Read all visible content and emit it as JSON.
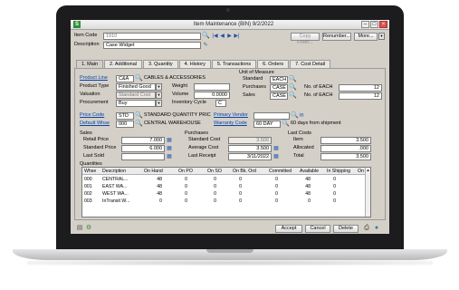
{
  "window": {
    "title": "Item Maintenance (BIN) 9/2/2022",
    "app_icon": "S"
  },
  "header": {
    "item_code_label": "Item Code",
    "item_code_value": "1910",
    "description_label": "Description",
    "description_value": "Case Widget",
    "copy_from_label": "Copy From...",
    "renumber_label": "Renumber...",
    "more_label": "More..."
  },
  "tabs": [
    "1. Main",
    "2. Additional",
    "3. Quantity",
    "4. History",
    "5. Transactions",
    "6. Orders",
    "7. Cost Detail"
  ],
  "main": {
    "product_line_label": "Product Line",
    "product_line_value": "C&A",
    "product_line_desc": "CABLES & ACCESSORIES",
    "product_type_label": "Product Type",
    "product_type_value": "Finished Good",
    "valuation_label": "Valuation",
    "valuation_value": "Standard Cost",
    "procurement_label": "Procurement",
    "procurement_value": "Buy",
    "weight_label": "Weight",
    "weight_value": "",
    "volume_label": "Volume",
    "volume_value": "0.0000",
    "inventory_cycle_label": "Inventory Cycle",
    "inventory_cycle_value": "C",
    "uom_title": "Unit of Measure",
    "uom_standard_label": "Standard",
    "uom_standard_value": "EACH",
    "uom_purchases_label": "Purchases",
    "uom_purchases_value": "CASE",
    "uom_sales_label": "Sales",
    "uom_sales_value": "CASE",
    "no_of_each_label": "No. of  EACH",
    "no_of_each_purchases": "12",
    "no_of_each_sales": "12",
    "price_code_label": "Price Code",
    "price_code_value": "STD",
    "price_code_desc": "STANDARD QUANTITY PRIC",
    "default_whse_label": "Default Whse",
    "default_whse_value": "000",
    "default_whse_desc": "CENTRAL WAREHOUSE",
    "primary_vendor_label": "Primary Vendor",
    "primary_vendor_value": "",
    "warranty_code_label": "Warranty Code",
    "warranty_code_value": "60 DAY",
    "warranty_desc": "60 days from shipment",
    "sales_title": "Sales",
    "retail_price_label": "Retail Price",
    "retail_price_value": "7.000",
    "standard_price_label": "Standard Price",
    "standard_price_value": "6.000",
    "last_sold_label": "Last Sold",
    "last_sold_value": "",
    "purchases_title": "Purchases",
    "standard_cost_label": "Standard Cost",
    "standard_cost_value": "3.500",
    "average_cost_label": "Average Cost",
    "average_cost_value": "3.500",
    "last_receipt_label": "Last Receipt",
    "last_receipt_value": "3/11/2022",
    "last_costs_title": "Last Costs",
    "lc_item_label": "Item",
    "lc_item_value": "3.500",
    "lc_allocated_label": "Allocated",
    "lc_allocated_value": ".000",
    "lc_total_label": "Total",
    "lc_total_value": "3.500"
  },
  "quantities": {
    "title": "Quantities",
    "columns": [
      "Whse",
      "Description",
      "On Hand",
      "On PO",
      "On SO",
      "On Bk. Ord",
      "Committed",
      "Available",
      "In Shipping",
      "On"
    ],
    "rows": [
      [
        "000",
        "CENTRAL...",
        "48",
        "0",
        "0",
        "0",
        "0",
        "48",
        "0",
        ""
      ],
      [
        "001",
        "EAST WA...",
        "48",
        "0",
        "0",
        "0",
        "0",
        "48",
        "0",
        ""
      ],
      [
        "002",
        "WEST WA...",
        "48",
        "0",
        "0",
        "0",
        "0",
        "48",
        "0",
        ""
      ],
      [
        "003",
        "InTransit W...",
        "0",
        "0",
        "0",
        "0",
        "0",
        "0",
        "0",
        ""
      ]
    ]
  },
  "footer": {
    "accept_label": "Accept",
    "cancel_label": "Cancel",
    "delete_label": "Delete"
  },
  "colors": {
    "title_bar": "#dcdcdc",
    "form_bg": "#d4d0c8",
    "link": "#0645ad",
    "app_icon": "#2f8f3a"
  }
}
